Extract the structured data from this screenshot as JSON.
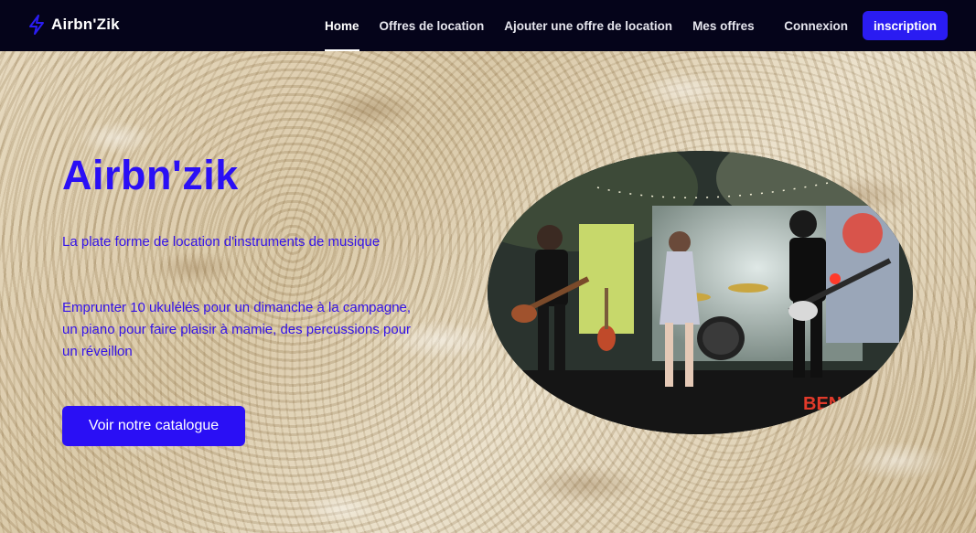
{
  "brand": {
    "name": "Airbn'Zik",
    "icon": "bolt-icon"
  },
  "nav": {
    "items": [
      {
        "label": "Home",
        "active": true
      },
      {
        "label": "Offres de location",
        "active": false
      },
      {
        "label": "Ajouter une offre de location",
        "active": false
      },
      {
        "label": "Mes offres",
        "active": false
      }
    ],
    "login_label": "Connexion",
    "signup_label": "inscription"
  },
  "hero": {
    "title": "Airbn'zik",
    "lead": "La plate forme de location d'instruments de musique",
    "description": "Emprunter 10 ukulélés pour un dimanche à la campagne, un piano pour faire plaisir à mamie, des percussions pour un réveillon",
    "cta_label": "Voir notre catalogue",
    "photo_sign": "BEN"
  },
  "colors": {
    "navbar_bg": "#05041a",
    "accent": "#2a0ff5",
    "signup_bg": "#2a1cf2",
    "text_light": "#ffffff"
  }
}
